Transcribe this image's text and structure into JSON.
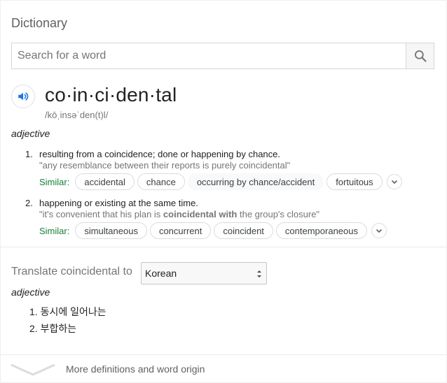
{
  "card": {
    "title": "Dictionary"
  },
  "search": {
    "placeholder": "Search for a word",
    "value": ""
  },
  "entry": {
    "headword": "co·in·ci·den·tal",
    "phonetic": "/kōˌinsəˈden(t)l/",
    "part_of_speech": "adjective",
    "senses": [
      {
        "number": "1.",
        "definition": "resulting from a coincidence; done or happening by chance.",
        "example": "\"any resemblance between their reports is purely coincidental\"",
        "similar_label": "Similar:",
        "similar": [
          "accidental",
          "chance",
          "occurring by chance/accident",
          "fortuitous"
        ]
      },
      {
        "number": "2.",
        "definition": "happening or existing at the same time.",
        "example_pre": "\"it's convenient that his plan is ",
        "example_bold": "coincidental with",
        "example_post": " the group's closure\"",
        "similar_label": "Similar:",
        "similar": [
          "simultaneous",
          "concurrent",
          "coincident",
          "contemporaneous"
        ]
      }
    ]
  },
  "translate": {
    "label": "Translate coincidental to",
    "language": "Korean",
    "part_of_speech": "adjective",
    "items": [
      {
        "number": "1.",
        "text": "동시에 일어나는"
      },
      {
        "number": "2.",
        "text": "부합하는"
      }
    ]
  },
  "footer": {
    "more_label": "More definitions and word origin"
  },
  "icons": {
    "search": "search-icon",
    "speaker": "speaker-icon",
    "expand": "chevron-down-icon"
  },
  "colors": {
    "accent": "#1a73e8",
    "similar_label": "#188038"
  }
}
